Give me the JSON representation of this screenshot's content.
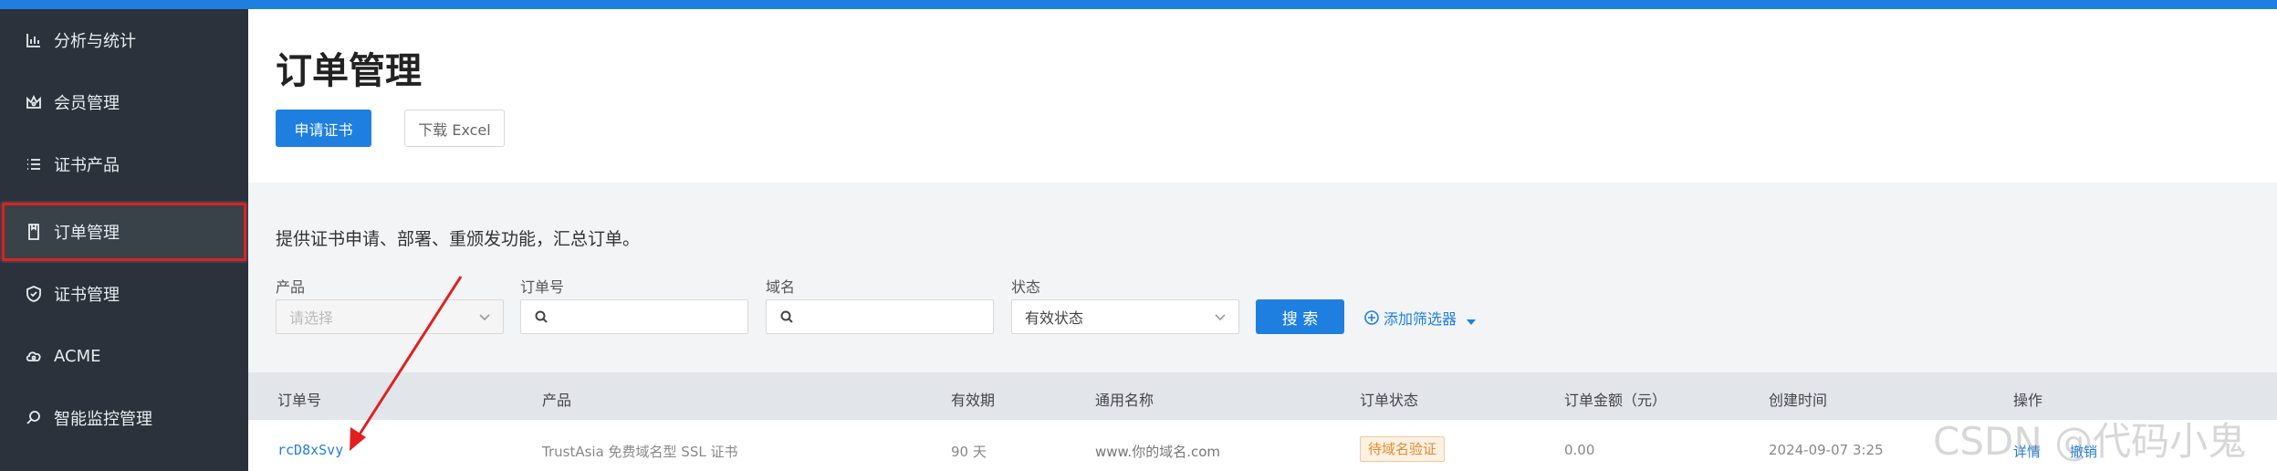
{
  "colors": {
    "accent": "#1f7fe0",
    "sidebar_bg": "#2b323b",
    "highlight_box": "#e02020",
    "annotation_arrow": "#e02020",
    "badge_orange": "#e58a2c"
  },
  "sidebar": {
    "items": [
      {
        "label": "分析与统计",
        "icon": "bar-chart-icon"
      },
      {
        "label": "会员管理",
        "icon": "crown-icon"
      },
      {
        "label": "证书产品",
        "icon": "list-icon"
      },
      {
        "label": "订单管理",
        "icon": "document-icon",
        "active": true
      },
      {
        "label": "证书管理",
        "icon": "shield-check-icon"
      },
      {
        "label": "ACME",
        "icon": "cloud-icon"
      },
      {
        "label": "智能监控管理",
        "icon": "search-icon"
      }
    ]
  },
  "page": {
    "title": "订单管理",
    "apply_button": "申请证书",
    "download_button": "下载 Excel",
    "description": "提供证书申请、部署、重颁发功能，汇总订单。"
  },
  "filters": {
    "product": {
      "label": "产品",
      "placeholder": "请选择"
    },
    "order_no": {
      "label": "订单号",
      "value": ""
    },
    "domain": {
      "label": "域名",
      "value": ""
    },
    "status": {
      "label": "状态",
      "value": "有效状态"
    },
    "search_button": "搜 索",
    "add_filter": "添加筛选器"
  },
  "table": {
    "headers": [
      "订单号",
      "产品",
      "有效期",
      "通用名称",
      "订单状态",
      "订单金额（元）",
      "创建时间",
      "操作"
    ],
    "rows": [
      {
        "order_no": "rcD8xSvy",
        "product": "TrustAsia 免费域名型 SSL 证书",
        "validity": "90 天",
        "common_name": "www.你的域名.com",
        "status": "待域名验证",
        "amount": "0.00",
        "created": "2024-09-07 3:25",
        "action_detail": "详情",
        "action_more": "撤销"
      }
    ]
  },
  "watermark": "CSDN @代码小鬼"
}
